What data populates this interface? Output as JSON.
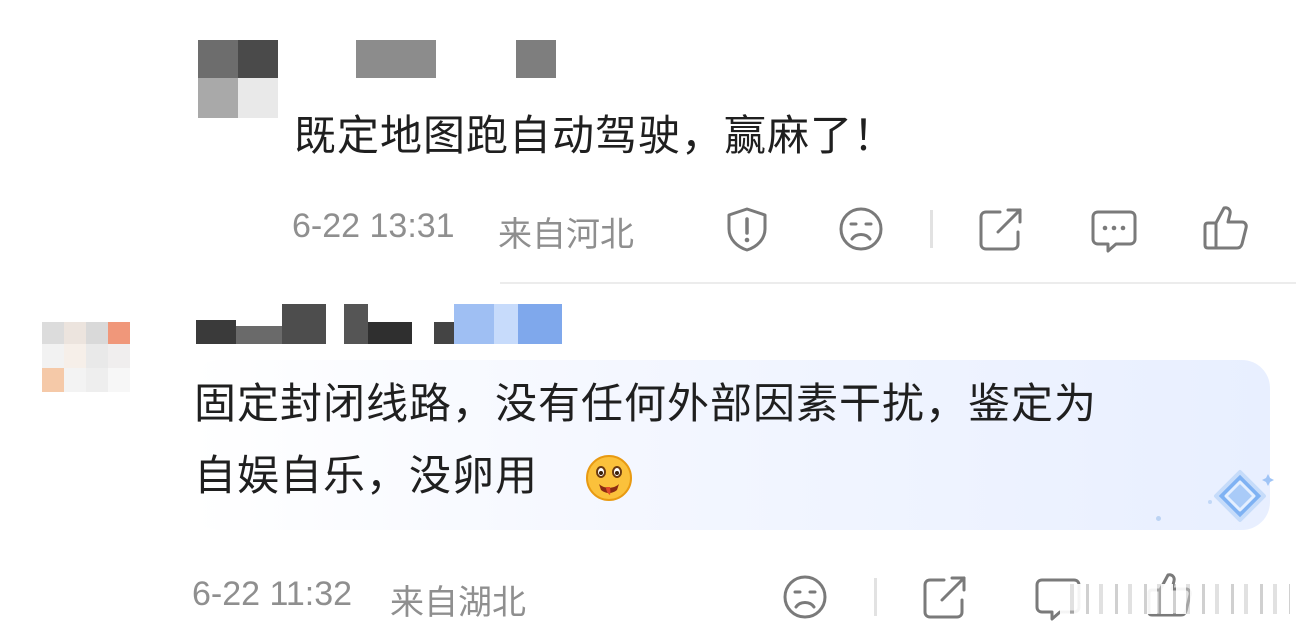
{
  "comments": [
    {
      "text": "既定地图跑自动驾驶，赢麻了！",
      "time": "6-22 13:31",
      "location": "来自河北"
    },
    {
      "text_line1": "固定封闭线路，没有任何外部因素干扰，鉴定为",
      "text_line2": "自娱自乐，没卵用",
      "time": "6-22 11:32",
      "location": "来自湖北"
    }
  ],
  "icons": {
    "report": "report-icon",
    "dislike": "sad-face-icon",
    "share": "share-icon",
    "comment": "comment-icon",
    "like": "thumbs-up-icon",
    "emoji": "drooling-face-emoji",
    "badge": "diamond-badge-icon"
  },
  "colors": {
    "meta_text": "#8f8f8f",
    "icon_stroke": "#7a7a7a",
    "highlight_bg": "#e8efff"
  }
}
